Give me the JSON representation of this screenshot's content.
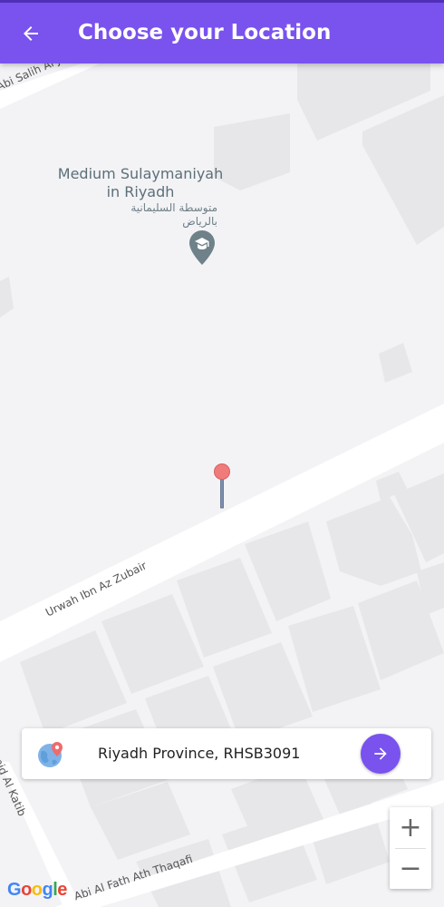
{
  "header": {
    "title": "Choose your Location",
    "back_icon": "arrow-back-icon",
    "background": "#7a52ee"
  },
  "map": {
    "poi": {
      "name": "Medium Sulaymaniyah in Riyadh",
      "name_ar_line1": "متوسطة السليمانية",
      "name_ar_line2": "بالرياض",
      "icon": "school-pin-icon"
    },
    "roads": {
      "top": "Abi Salih Al Jaili",
      "middle": "Urwah Ibn Az Zubair",
      "left": "mid Al Katib",
      "bottom": "Abi Al Fath Ath Thaqafi"
    },
    "marker_icon": "location-pin-icon"
  },
  "address_card": {
    "text": "Riyadh Province, RHSB3091",
    "icon": "globe-location-icon",
    "go_icon": "arrow-forward-icon",
    "accent": "#7a52ee"
  },
  "zoom": {
    "in_label": "+",
    "out_label": "−"
  },
  "attribution": {
    "letters": [
      "G",
      "o",
      "o",
      "g",
      "l",
      "e"
    ]
  }
}
